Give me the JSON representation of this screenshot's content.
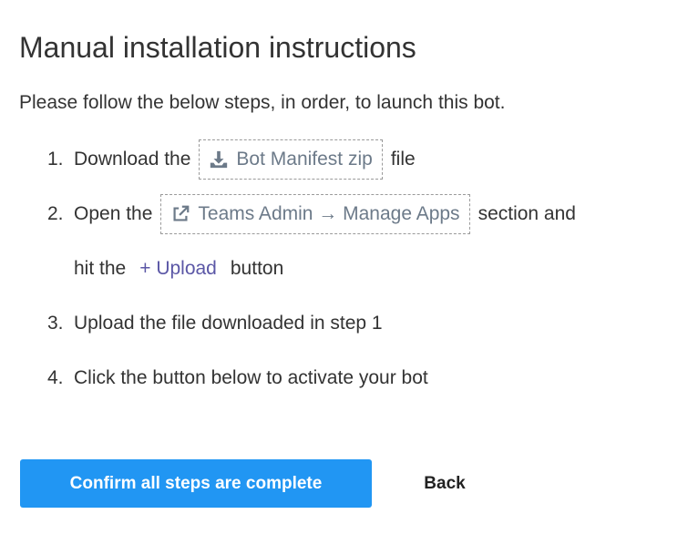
{
  "page": {
    "title": "Manual installation instructions",
    "intro": "Please follow the below steps, in order, to launch this bot."
  },
  "steps": [
    {
      "number": "1.",
      "prefix": "Download the",
      "link": {
        "icon": "download-icon",
        "label": "Bot Manifest zip"
      },
      "suffix": "file"
    },
    {
      "number": "2.",
      "prefix": "Open the",
      "link": {
        "icon": "external-link-icon",
        "label": "Teams Admin → Manage Apps"
      },
      "suffix": "section and",
      "continuation": {
        "prefix": "hit the",
        "link_label": "+ Upload",
        "suffix": "button"
      }
    },
    {
      "number": "3.",
      "text": "Upload the file downloaded in step 1"
    },
    {
      "number": "4.",
      "text": "Click the button below to activate your bot"
    }
  ],
  "actions": {
    "confirm_label": "Confirm all steps are complete",
    "back_label": "Back"
  },
  "colors": {
    "primary_button": "#2196f3",
    "link_muted": "#6c7a89",
    "upload_link": "#5b57a6",
    "text": "#333333"
  }
}
